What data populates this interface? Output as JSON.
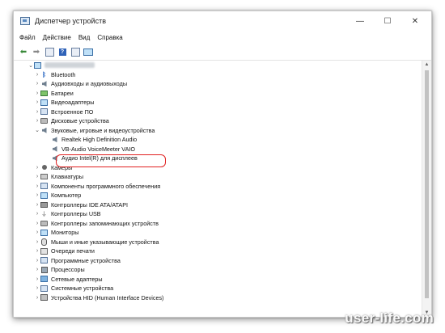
{
  "window": {
    "title": "Диспетчер устройств",
    "controls": {
      "minimize": "—",
      "maximize": "☐",
      "close": "✕"
    }
  },
  "menu": [
    "Файл",
    "Действие",
    "Вид",
    "Справка"
  ],
  "toolbar": [
    "back-icon",
    "forward-icon",
    "properties-icon",
    "help-icon",
    "properties-pane-icon",
    "monitor-icon"
  ],
  "tree": {
    "root": {
      "arrow": "⌄"
    },
    "items": [
      {
        "arrow": "›",
        "icon": "bluetooth",
        "label": "Bluetooth"
      },
      {
        "arrow": "›",
        "icon": "speaker",
        "label": "Аудиовходы и аудиовыходы"
      },
      {
        "arrow": "›",
        "icon": "battery",
        "label": "Батареи"
      },
      {
        "arrow": "›",
        "icon": "monitor",
        "label": "Видеоадаптеры"
      },
      {
        "arrow": "›",
        "icon": "chip",
        "label": "Встроенное ПО"
      },
      {
        "arrow": "›",
        "icon": "disk",
        "label": "Дисковые устройства"
      },
      {
        "arrow": "⌄",
        "icon": "speaker",
        "label": "Звуковые, игровые и видеоустройства"
      },
      {
        "arrow": "",
        "icon": "speaker",
        "label": "Realtek High Definition Audio",
        "indent": 1
      },
      {
        "arrow": "",
        "icon": "speaker",
        "label": "VB-Audio VoiceMeeter VAIO",
        "indent": 1
      },
      {
        "arrow": "",
        "icon": "speaker",
        "label": "Аудио Intel(R) для дисплеев",
        "indent": 1
      },
      {
        "arrow": "›",
        "icon": "camera",
        "label": "Камеры"
      },
      {
        "arrow": "›",
        "icon": "keyboard",
        "label": "Клавиатуры"
      },
      {
        "arrow": "›",
        "icon": "chip",
        "label": "Компоненты программного обеспечения"
      },
      {
        "arrow": "›",
        "icon": "computer",
        "label": "Компьютер"
      },
      {
        "arrow": "›",
        "icon": "ide",
        "label": "Контроллеры IDE ATA/ATAPI"
      },
      {
        "arrow": "›",
        "icon": "usb",
        "label": "Контроллеры USB"
      },
      {
        "arrow": "›",
        "icon": "storage",
        "label": "Контроллеры запоминающих устройств"
      },
      {
        "arrow": "›",
        "icon": "monitor",
        "label": "Мониторы"
      },
      {
        "arrow": "›",
        "icon": "mouse",
        "label": "Мыши и иные указывающие устройства"
      },
      {
        "arrow": "›",
        "icon": "printer",
        "label": "Очереди печати"
      },
      {
        "arrow": "›",
        "icon": "chip",
        "label": "Программные устройства"
      },
      {
        "arrow": "›",
        "icon": "cpu",
        "label": "Процессоры"
      },
      {
        "arrow": "›",
        "icon": "network",
        "label": "Сетевые адаптеры"
      },
      {
        "arrow": "›",
        "icon": "system",
        "label": "Системные устройства"
      },
      {
        "arrow": "›",
        "icon": "hid",
        "label": "Устройства HID (Human Interface Devices)"
      }
    ]
  },
  "watermark": "user-life.com"
}
